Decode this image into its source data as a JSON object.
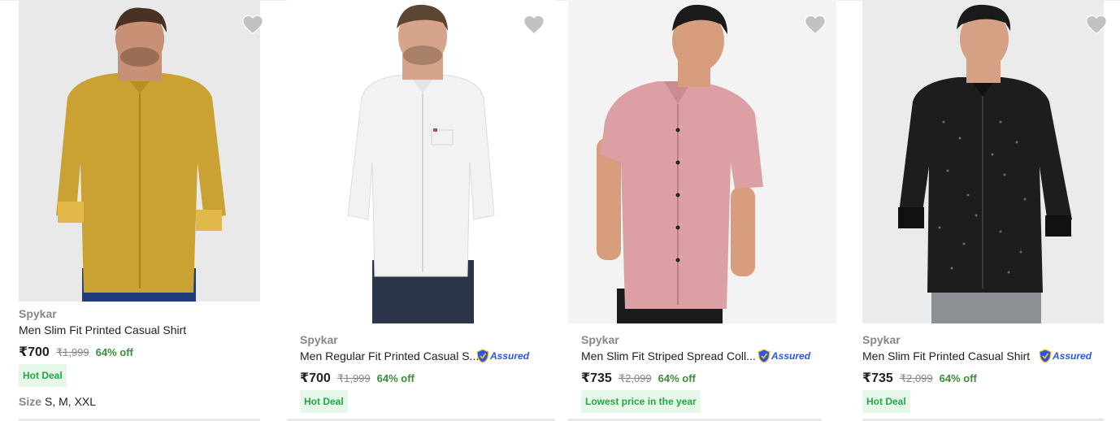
{
  "products": [
    {
      "brand": "Spykar",
      "title": "Men Slim Fit Printed Casual Shirt",
      "price": "₹700",
      "mrp": "₹1,999",
      "discount": "64% off",
      "badge": "Hot Deal",
      "size_label": "Size",
      "sizes": "S, M, XXL",
      "assured": false,
      "shirt_color": "#c9a233",
      "image_icon": "yellow-printed-shirt-image"
    },
    {
      "brand": "Spykar",
      "title": "Men Regular Fit Printed Casual S...",
      "price": "₹700",
      "mrp": "₹1,999",
      "discount": "64% off",
      "badge": "Hot Deal",
      "assured": true,
      "assured_label": "Assured",
      "shirt_color": "#f2f2f2",
      "image_icon": "white-printed-shirt-image"
    },
    {
      "brand": "Spykar",
      "title": "Men Slim Fit Striped Spread Coll...",
      "price": "₹735",
      "mrp": "₹2,099",
      "discount": "64% off",
      "badge": "Lowest price in the year",
      "assured": true,
      "assured_label": "Assured",
      "shirt_color": "#dca0a4",
      "image_icon": "pink-striped-shirt-image"
    },
    {
      "brand": "Spykar",
      "title": "Men Slim Fit Printed Casual Shirt",
      "price": "₹735",
      "mrp": "₹2,099",
      "discount": "64% off",
      "badge": "Hot Deal",
      "assured": true,
      "assured_label": "Assured",
      "shirt_color": "#1d1d1d",
      "image_icon": "black-printed-shirt-image"
    }
  ],
  "colors": {
    "accent": "#2874f0",
    "discount_green": "#388e3c",
    "badge_bg": "#e6f8ea",
    "assured_blue": "#2a55e5"
  }
}
